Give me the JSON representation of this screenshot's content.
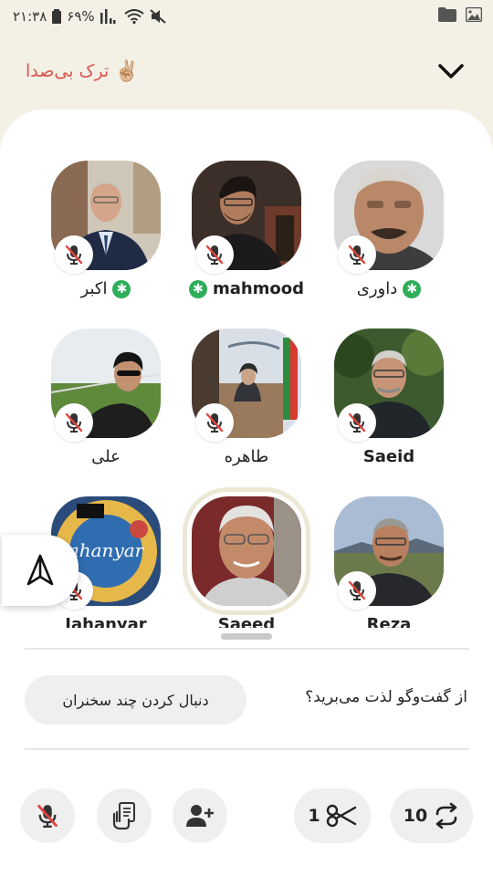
{
  "status_bar": {
    "time": "۲۱:۳۸",
    "battery": "۶۹%",
    "icons": [
      "battery-icon",
      "signal-icon",
      "wifi-icon",
      "mute-icon",
      "folder-icon",
      "image-icon"
    ]
  },
  "header": {
    "leave_label": "ترک بی‌صدا",
    "leave_emoji": "✌🏼"
  },
  "speakers": [
    {
      "name": "اکبر",
      "badge": true,
      "bold": false,
      "muted": true
    },
    {
      "name": "mahmood",
      "badge": true,
      "bold": true,
      "muted": true
    },
    {
      "name": "داوری",
      "badge": true,
      "bold": false,
      "muted": true
    },
    {
      "name": "علی",
      "badge": false,
      "bold": false,
      "muted": true
    },
    {
      "name": "طاهره",
      "badge": false,
      "bold": false,
      "muted": true
    },
    {
      "name": "Saeid",
      "badge": false,
      "bold": true,
      "muted": true
    },
    {
      "name": "Jahanyar",
      "badge": false,
      "bold": true,
      "muted": true
    },
    {
      "name": "Saeed",
      "badge": false,
      "bold": true,
      "muted": false
    },
    {
      "name": "Reza",
      "badge": false,
      "bold": true,
      "muted": true
    }
  ],
  "footer": {
    "prompt": "از گفت‌وگو لذت می‌برید؟",
    "follow_label": "دنبال کردن چند سخنران"
  },
  "toolbar": {
    "clip_count": "1",
    "replay_count": "10"
  },
  "colors": {
    "background": "#f3f0e6",
    "leave_red": "#d9544e",
    "badge_green": "#2eae59",
    "mic_red": "#e0443c"
  }
}
